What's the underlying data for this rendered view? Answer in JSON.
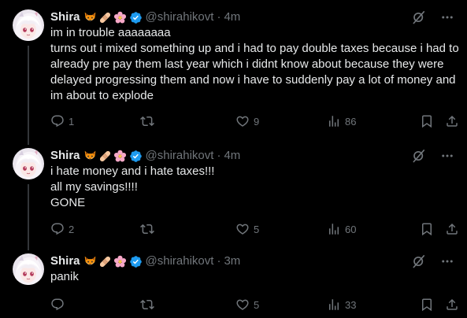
{
  "tweets": [
    {
      "name": "Shira",
      "emojis": [
        "fox-emoji",
        "bandage-emoji",
        "flower-emoji"
      ],
      "handle": "@shirahikovt",
      "separator": "·",
      "time": "4m",
      "text": "im in trouble aaaaaaaa\nturns out i mixed something up and i had to pay double taxes because i had to already pre pay them last year which i didnt know about because they were delayed progressing them and now i have to suddenly pay a lot of money and im about to explode",
      "replies": "1",
      "retweets": "",
      "likes": "9",
      "views": "86"
    },
    {
      "name": "Shira",
      "emojis": [
        "fox-emoji",
        "bandage-emoji",
        "flower-emoji"
      ],
      "handle": "@shirahikovt",
      "separator": "·",
      "time": "4m",
      "text": "i hate money and i hate taxes!!!\nall my savings!!!!\nGONE",
      "replies": "2",
      "retweets": "",
      "likes": "5",
      "views": "60"
    },
    {
      "name": "Shira",
      "emojis": [
        "fox-emoji",
        "bandage-emoji",
        "flower-emoji"
      ],
      "handle": "@shirahikovt",
      "separator": "·",
      "time": "3m",
      "text": "panik",
      "replies": "",
      "retweets": "",
      "likes": "5",
      "views": "33"
    }
  ],
  "colors": {
    "background": "#000000",
    "text": "#e7e9ea",
    "muted": "#71767b",
    "verified": "#1d9bf0",
    "thread_line": "#333639"
  }
}
